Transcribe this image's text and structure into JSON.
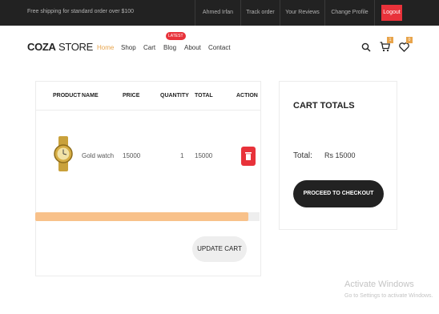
{
  "topbar": {
    "shipping_text": "Free shipping for standard order over $100",
    "links": [
      "Ahmed Irfan",
      "Track order",
      "Your Reviews",
      "Change Profile"
    ],
    "logout_label": "Logout"
  },
  "header": {
    "logo_bold": "COZA",
    "logo_light": " STORE",
    "nav": [
      "Home",
      "Shop",
      "Cart",
      "Blog",
      "About",
      "Contact"
    ],
    "active_nav": "Home",
    "blog_badge": "LATEST",
    "cart_count": "1",
    "wishlist_count": "0"
  },
  "cart": {
    "columns": [
      "PRODUCT",
      "NAME",
      "PRICE",
      "QUANTITY",
      "TOTAL",
      "ACTION"
    ],
    "rows": [
      {
        "name": "Gold watch",
        "price": "15000",
        "quantity": "1",
        "total": "15000"
      }
    ],
    "progress_fraction": 0.95,
    "update_label": "UPDATE CART"
  },
  "totals": {
    "title": "CART TOTALS",
    "total_label": "Total:",
    "total_value": "Rs 15000",
    "checkout_label": "PROCEED TO CHECKOUT"
  },
  "watermark": {
    "title": "Activate Windows",
    "subtitle": "Go to Settings to activate Windows."
  },
  "colors": {
    "accent": "#e8a44b",
    "danger": "#e8323a",
    "dark": "#222222",
    "progress": "#f8c18a"
  }
}
